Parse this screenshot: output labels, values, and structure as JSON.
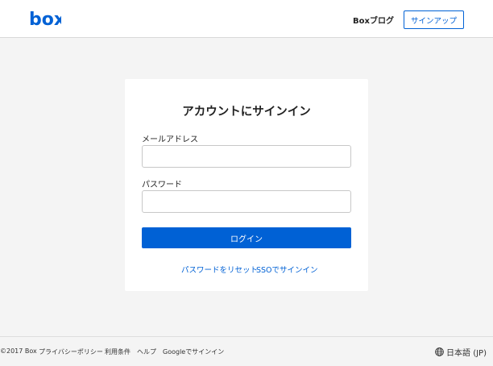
{
  "header": {
    "logo_text": "box",
    "blog_label": "Boxブログ",
    "signup_label": "サインアップ"
  },
  "card": {
    "title": "アカウントにサインイン",
    "email_label": "メールアドレス",
    "email_value": "",
    "password_label": "パスワード",
    "password_value": "",
    "login_label": "ログイン",
    "reset_link": "パスワードをリセット",
    "sso_link": "SSOでサインイン"
  },
  "footer": {
    "copyright": "©2017 Box",
    "links": [
      "プライバシーポリシー",
      "利用条件",
      "ヘルプ",
      "Googleでサインイン"
    ],
    "language": "日本語 (JP)"
  },
  "colors": {
    "brand": "#0061d5",
    "background": "#f4f4f4",
    "card": "#ffffff"
  },
  "icons": {
    "logo": "box-logo-icon",
    "language": "globe-icon"
  }
}
